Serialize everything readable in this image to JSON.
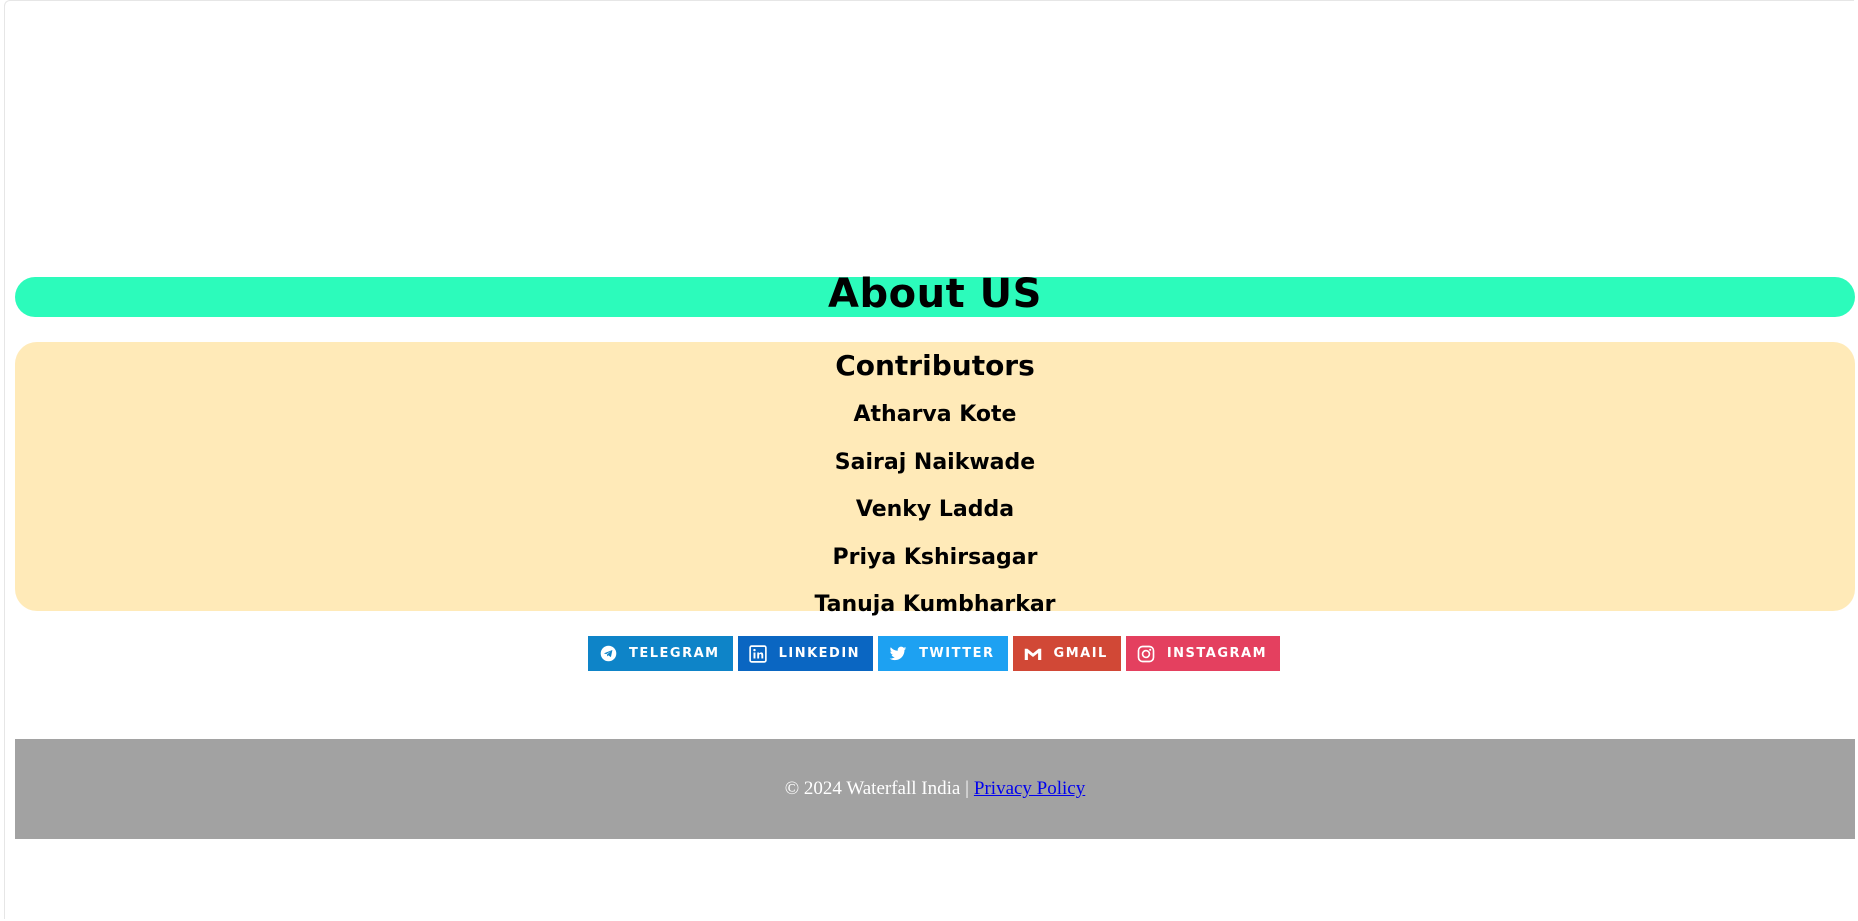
{
  "about": {
    "title": "About US"
  },
  "contributors": {
    "heading": "Contributors",
    "names": [
      "Atharva Kote",
      "Sairaj Naikwade",
      "Venky Ladda",
      "Priya Kshirsagar",
      "Tanuja Kumbharkar"
    ]
  },
  "social": {
    "buttons": [
      {
        "label": "TELEGRAM",
        "icon": "telegram-icon",
        "color": "#0e84c8"
      },
      {
        "label": "LINKEDIN",
        "icon": "linkedin-icon",
        "color": "#0a66c2"
      },
      {
        "label": "TWITTER",
        "icon": "twitter-icon",
        "color": "#1da1f2"
      },
      {
        "label": "GMAIL",
        "icon": "gmail-icon",
        "color": "#d14836"
      },
      {
        "label": "INSTAGRAM",
        "icon": "instagram-icon",
        "color": "#e4405f"
      }
    ]
  },
  "footer": {
    "copyright": "© 2024 Waterfall India |",
    "privacy_link": "Privacy Policy"
  },
  "colors": {
    "about_bar": "#2cfbbb",
    "contrib_bg": "#ffeab8",
    "footer_bg": "#a2a2a2"
  }
}
